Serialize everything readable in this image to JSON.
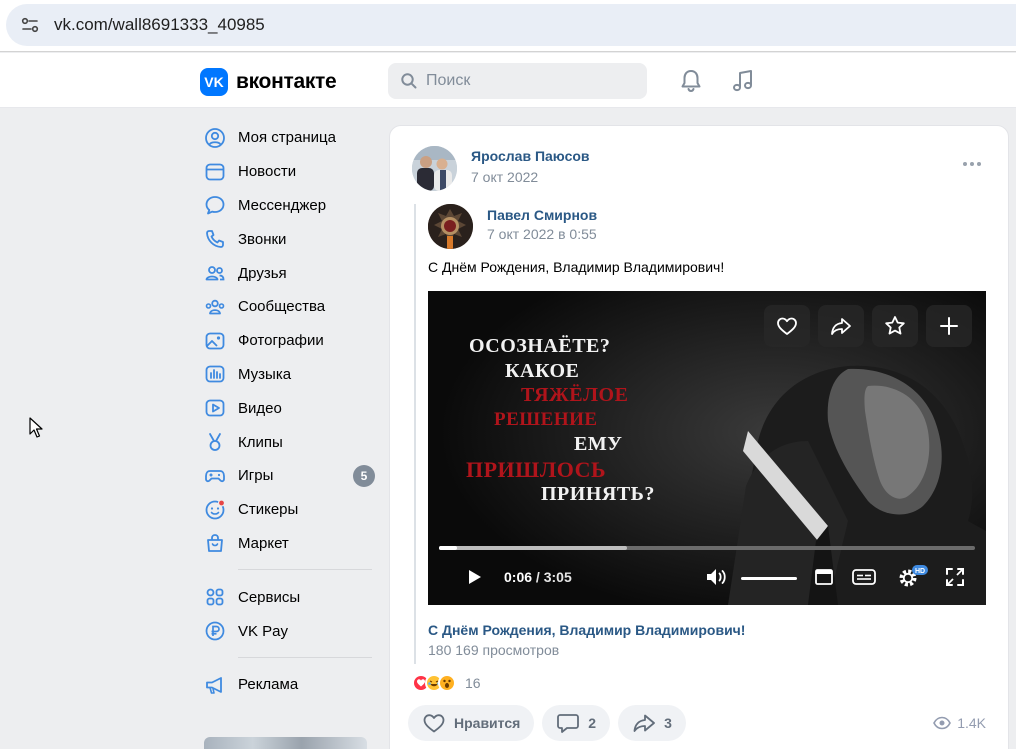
{
  "browser": {
    "url": "vk.com/wall8691333_40985"
  },
  "header": {
    "logo_mark": "VK",
    "logo_text": "вконтакте",
    "search_placeholder": "Поиск"
  },
  "sidebar": {
    "items": [
      {
        "label": "Моя страница",
        "icon": "profile-icon"
      },
      {
        "label": "Новости",
        "icon": "news-icon"
      },
      {
        "label": "Мессенджер",
        "icon": "messenger-icon"
      },
      {
        "label": "Звонки",
        "icon": "phone-icon"
      },
      {
        "label": "Друзья",
        "icon": "friends-icon"
      },
      {
        "label": "Сообщества",
        "icon": "communities-icon"
      },
      {
        "label": "Фотографии",
        "icon": "photos-icon"
      },
      {
        "label": "Музыка",
        "icon": "music-icon"
      },
      {
        "label": "Видео",
        "icon": "video-icon"
      },
      {
        "label": "Клипы",
        "icon": "clips-icon"
      },
      {
        "label": "Игры",
        "icon": "games-icon",
        "badge": "5"
      },
      {
        "label": "Стикеры",
        "icon": "stickers-icon"
      },
      {
        "label": "Маркет",
        "icon": "market-icon"
      }
    ],
    "group2": [
      {
        "label": "Сервисы",
        "icon": "services-icon"
      },
      {
        "label": "VK Pay",
        "icon": "vkpay-icon"
      }
    ],
    "group3": [
      {
        "label": "Реклама",
        "icon": "ads-icon"
      }
    ]
  },
  "post": {
    "author": "Ярослав Паюсов",
    "date": "7 окт 2022",
    "repost": {
      "author": "Павел Смирнов",
      "date": "7 окт 2022 в 0:55",
      "text": "С Днём Рождения, Владимир Владимирович!"
    },
    "video": {
      "overlay": {
        "line1": "ОСОЗНАЁТЕ?",
        "line2": "КАКОЕ",
        "line3": "ТЯЖЁЛОЕ",
        "line4": "РЕШЕНИЕ",
        "line5": "ЕМУ",
        "line6": "ПРИШЛОСЬ",
        "line7": "ПРИНЯТЬ?"
      },
      "current_time": "0:06",
      "separator": " / ",
      "duration": "3:05",
      "played_fraction": 0.033,
      "buffered_fraction": 0.35,
      "volume_fraction": 1.0,
      "quality_badge": "HD",
      "title": "С Днём Рождения, Владимир Владимирович!",
      "views": "180 169 просмотров"
    },
    "reactions_count": "16",
    "like_label": "Нравится",
    "comments_count": "2",
    "shares_count": "3",
    "views_count": "1.4K"
  },
  "colors": {
    "accent": "#0077ff",
    "link": "#2a5885",
    "secondary_text": "#818c99",
    "overlay_red": "#b0141b"
  }
}
